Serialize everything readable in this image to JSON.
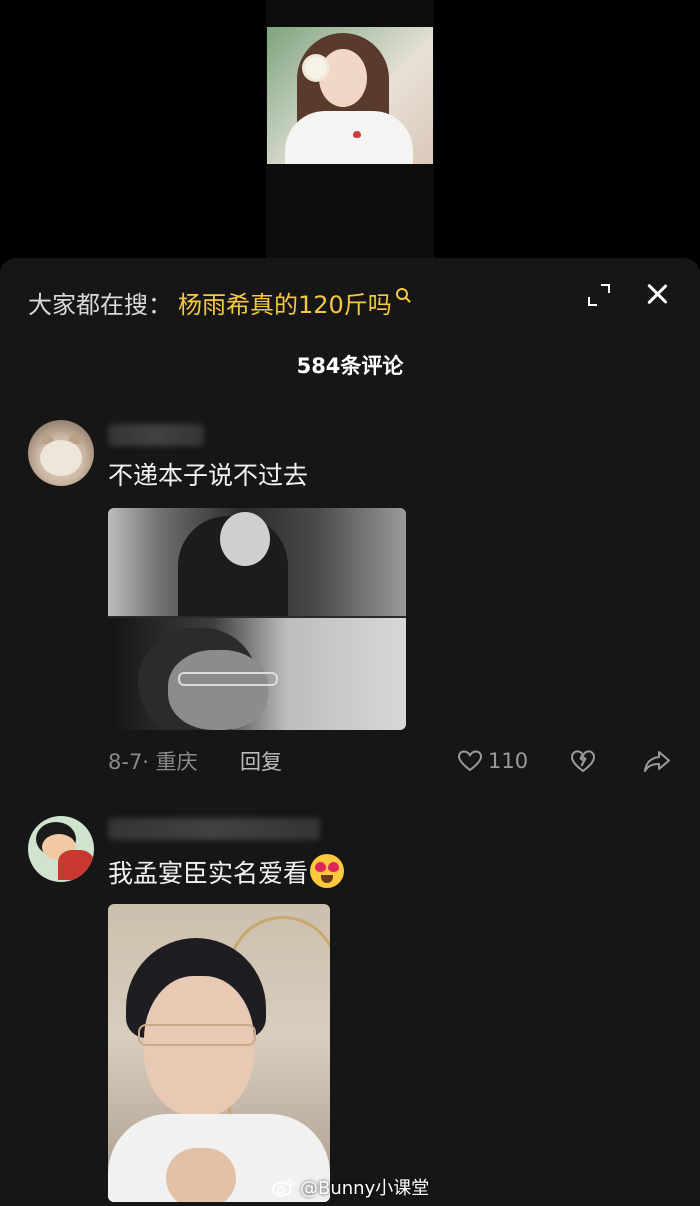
{
  "search": {
    "prefix": "大家都在搜：",
    "term": "杨雨希真的120斤吗"
  },
  "header": {
    "comment_count": "584条评论"
  },
  "comments": [
    {
      "text": "不递本子说不过去",
      "date_location": "8-7· 重庆",
      "reply_label": "回复",
      "likes": "110"
    },
    {
      "text": "我孟宴臣实名爱看"
    }
  ],
  "watermark": {
    "text": "@Bunny小课堂"
  },
  "colors": {
    "search_term": "#f5c842",
    "sheet_bg": "#161616"
  }
}
